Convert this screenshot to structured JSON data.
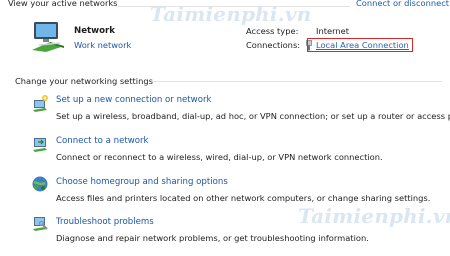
{
  "active_networks": {
    "header": "View your active networks",
    "connect_link": "Connect or disconnect",
    "network_name": "Network",
    "network_type": "Work network",
    "access_type_label": "Access type:",
    "access_type_value": "Internet",
    "connections_label": "Connections:",
    "connection_value": "Local Area Connection"
  },
  "settings": {
    "header": "Change your networking settings",
    "items": [
      {
        "title": "Set up a new connection or network",
        "desc": "Set up a wireless, broadband, dial-up, ad hoc, or VPN connection; or set up a router or access point."
      },
      {
        "title": "Connect to a network",
        "desc": "Connect or reconnect to a wireless, wired, dial-up, or VPN network connection."
      },
      {
        "title": "Choose homegroup and sharing options",
        "desc": "Access files and printers located on other network computers, or change sharing settings."
      },
      {
        "title": "Troubleshoot problems",
        "desc": "Diagnose and repair network problems, or get troubleshooting information."
      }
    ]
  },
  "watermark_text": "Taimienphi.vn",
  "colors": {
    "link": "#1c57a8",
    "highlight_box": "#d42a2a"
  }
}
